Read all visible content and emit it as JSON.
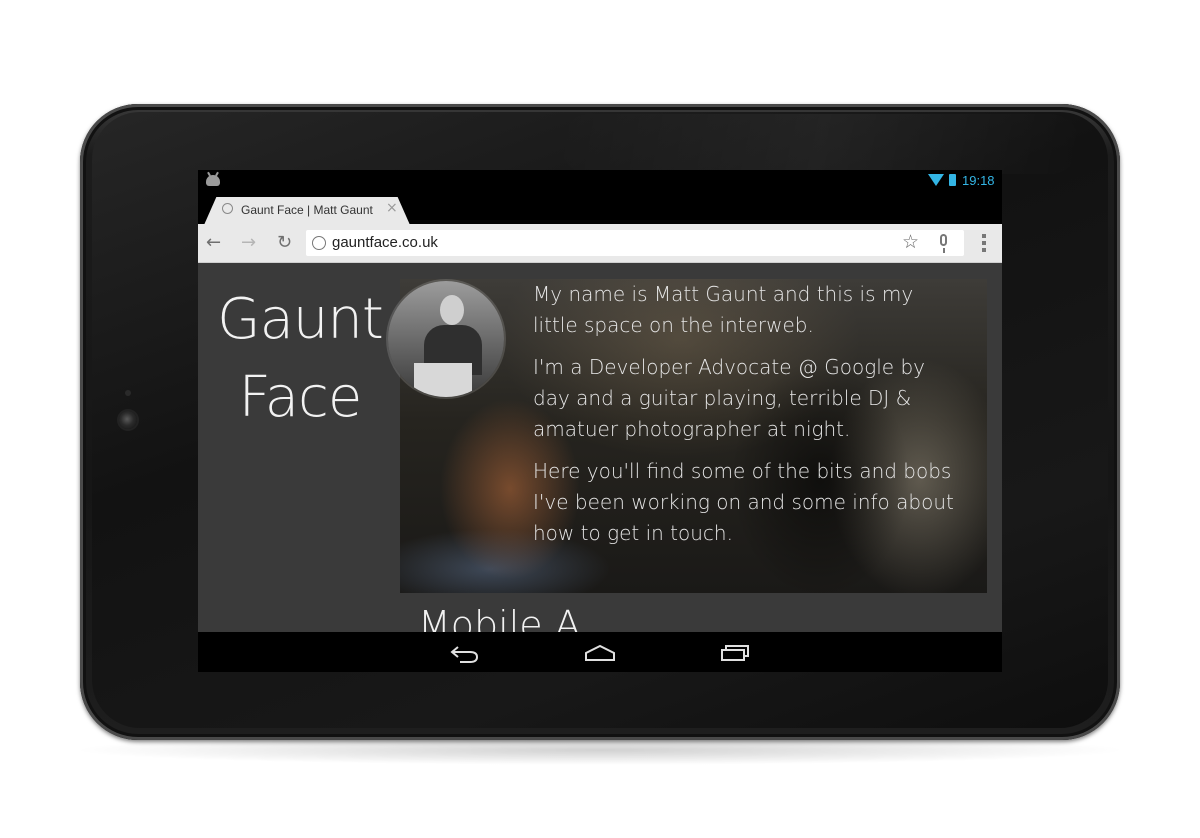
{
  "status_bar": {
    "time": "19:18",
    "icons": [
      "android-notification-icon",
      "wifi-icon",
      "battery-icon"
    ],
    "accent_color": "#33b5e5"
  },
  "browser": {
    "tab": {
      "title": "Gaunt Face | Matt Gaunt",
      "close_glyph": "×"
    },
    "toolbar": {
      "back_glyph": "←",
      "forward_glyph": "→",
      "reload_glyph": "↻",
      "url": "gauntface.co.uk",
      "star_glyph": "☆"
    }
  },
  "page": {
    "site_title_line1": "Gaunt",
    "site_title_line2": "Face",
    "bio": [
      "My name is Matt Gaunt and this is my little space on the interweb.",
      "I'm a Developer Advocate @ Google by day and a guitar playing, terrible DJ & amatuer photographer at night.",
      "Here you'll find some of the bits and bobs I've been working on and some info about how to get in touch."
    ],
    "section_heading_partial": "Mobile A"
  },
  "nav_bar": {
    "icons": [
      "back-icon",
      "home-icon",
      "recents-icon"
    ]
  }
}
